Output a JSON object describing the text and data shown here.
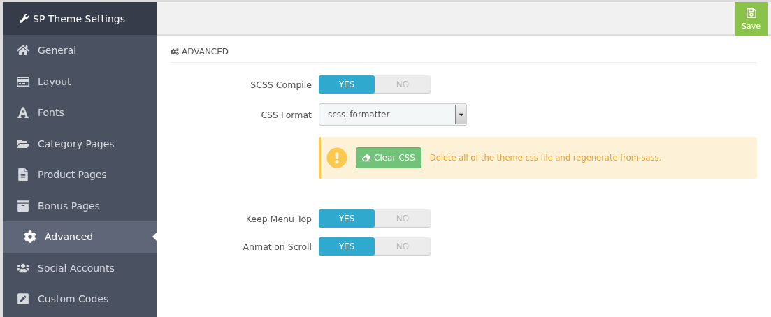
{
  "sidebar": {
    "title": "SP Theme Settings",
    "items": [
      {
        "label": "General",
        "selected": false
      },
      {
        "label": "Layout",
        "selected": false
      },
      {
        "label": "Fonts",
        "selected": false
      },
      {
        "label": "Category Pages",
        "selected": false
      },
      {
        "label": "Product Pages",
        "selected": false
      },
      {
        "label": "Bonus Pages",
        "selected": false
      },
      {
        "label": "Advanced",
        "selected": true
      },
      {
        "label": "Social Accounts",
        "selected": false
      },
      {
        "label": "Custom Codes",
        "selected": false
      }
    ]
  },
  "toolbar": {
    "save": "Save"
  },
  "section": {
    "title": "ADVANCED",
    "rows": [
      {
        "kind": "toggle",
        "label": "SCSS Compile",
        "options": [
          {
            "label": "YES",
            "selected": true
          },
          {
            "label": "NO",
            "selected": false
          }
        ]
      },
      {
        "kind": "select",
        "label": "CSS Format",
        "value": "scss_formatter"
      },
      {
        "kind": "alert",
        "button": "Clear CSS",
        "message": "Delete all of the theme css file and regenerate from sass."
      },
      {
        "kind": "toggle",
        "label": "Keep Menu Top",
        "options": [
          {
            "label": "YES",
            "selected": true
          },
          {
            "label": "NO",
            "selected": false
          }
        ]
      },
      {
        "kind": "toggle",
        "label": "Anmation Scroll",
        "options": [
          {
            "label": "YES",
            "selected": true
          },
          {
            "label": "NO",
            "selected": false
          }
        ]
      }
    ]
  }
}
